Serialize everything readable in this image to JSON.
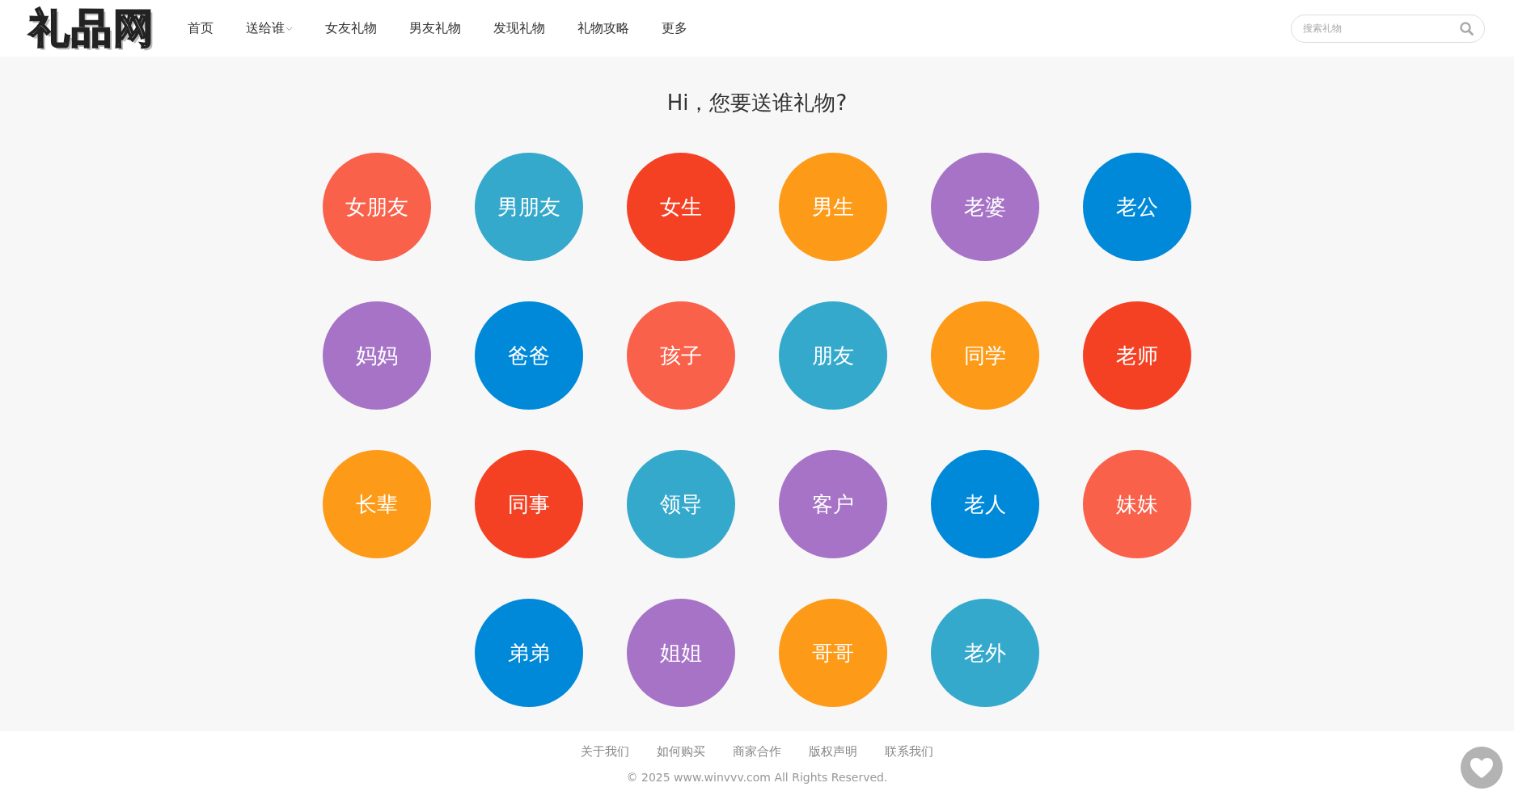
{
  "header": {
    "logo": "礼品网",
    "nav": [
      {
        "label": "首页",
        "dropdown": false
      },
      {
        "label": "送给谁",
        "dropdown": true
      },
      {
        "label": "女友礼物",
        "dropdown": false
      },
      {
        "label": "男友礼物",
        "dropdown": false
      },
      {
        "label": "发现礼物",
        "dropdown": false
      },
      {
        "label": "礼物攻略",
        "dropdown": false
      },
      {
        "label": "更多",
        "dropdown": false
      }
    ],
    "search": {
      "placeholder": "搜索礼物"
    }
  },
  "heading": "Hi，您要送谁礼物?",
  "recipients": [
    {
      "label": "女朋友",
      "color": "#f9614b"
    },
    {
      "label": "男朋友",
      "color": "#35a9cc"
    },
    {
      "label": "女生",
      "color": "#f44123"
    },
    {
      "label": "男生",
      "color": "#fd9a17"
    },
    {
      "label": "老婆",
      "color": "#a673c6"
    },
    {
      "label": "老公",
      "color": "#0089d9"
    },
    {
      "label": "妈妈",
      "color": "#a673c6"
    },
    {
      "label": "爸爸",
      "color": "#0089d9"
    },
    {
      "label": "孩子",
      "color": "#f9614b"
    },
    {
      "label": "朋友",
      "color": "#35a9cc"
    },
    {
      "label": "同学",
      "color": "#fd9a17"
    },
    {
      "label": "老师",
      "color": "#f44123"
    },
    {
      "label": "长辈",
      "color": "#fd9a17"
    },
    {
      "label": "同事",
      "color": "#f44123"
    },
    {
      "label": "领导",
      "color": "#35a9cc"
    },
    {
      "label": "客户",
      "color": "#a673c6"
    },
    {
      "label": "老人",
      "color": "#0089d9"
    },
    {
      "label": "妹妹",
      "color": "#f9614b"
    },
    {
      "label": "弟弟",
      "color": "#0089d9"
    },
    {
      "label": "姐姐",
      "color": "#a673c6"
    },
    {
      "label": "哥哥",
      "color": "#fd9a17"
    },
    {
      "label": "老外",
      "color": "#35a9cc"
    }
  ],
  "footer": {
    "links": [
      "关于我们",
      "如何购买",
      "商家合作",
      "版权声明",
      "联系我们"
    ],
    "copyright": "© 2025 www.winvvv.com All Rights Reserved."
  }
}
